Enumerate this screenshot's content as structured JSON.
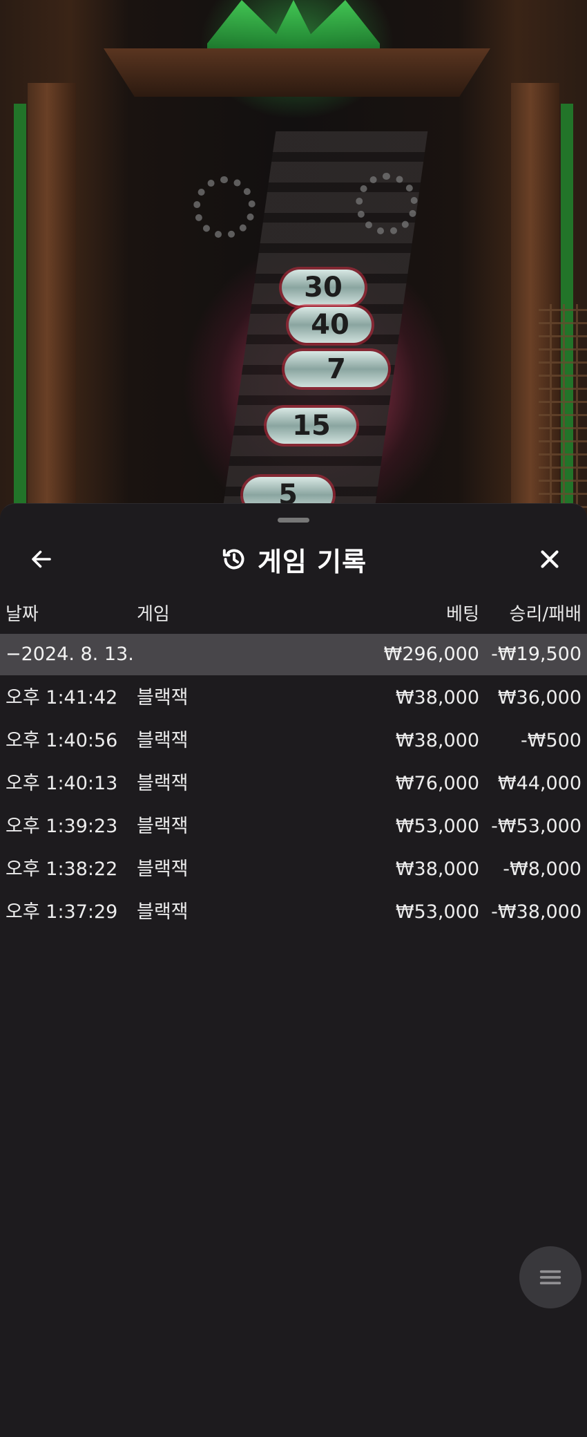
{
  "game_background": {
    "drum_numbers": [
      "30",
      "40",
      "7",
      "15",
      "5"
    ]
  },
  "history_sheet": {
    "title": "게임 기록",
    "icons": {
      "back": "arrow-left-icon",
      "history": "history-clock-icon",
      "close": "close-x-icon",
      "menu": "hamburger-menu-icon"
    },
    "columns": {
      "date": "날짜",
      "game": "게임",
      "bet": "베팅",
      "result": "승리/패배"
    },
    "date_group": {
      "label": "−2024. 8. 13.",
      "total_bet": "₩296,000",
      "total_result": "-₩19,500"
    },
    "rows": [
      {
        "time": "오후 1:41:42",
        "game": "블랙잭",
        "bet": "₩38,000",
        "result": "₩36,000"
      },
      {
        "time": "오후 1:40:56",
        "game": "블랙잭",
        "bet": "₩38,000",
        "result": "-₩500"
      },
      {
        "time": "오후 1:40:13",
        "game": "블랙잭",
        "bet": "₩76,000",
        "result": "₩44,000"
      },
      {
        "time": "오후 1:39:23",
        "game": "블랙잭",
        "bet": "₩53,000",
        "result": "-₩53,000"
      },
      {
        "time": "오후 1:38:22",
        "game": "블랙잭",
        "bet": "₩38,000",
        "result": "-₩8,000"
      },
      {
        "time": "오후 1:37:29",
        "game": "블랙잭",
        "bet": "₩53,000",
        "result": "-₩38,000"
      }
    ]
  },
  "colors": {
    "sheet_bg": "#1d1b1e",
    "date_row_bg": "#48464a",
    "text": "#f2f2f2"
  }
}
